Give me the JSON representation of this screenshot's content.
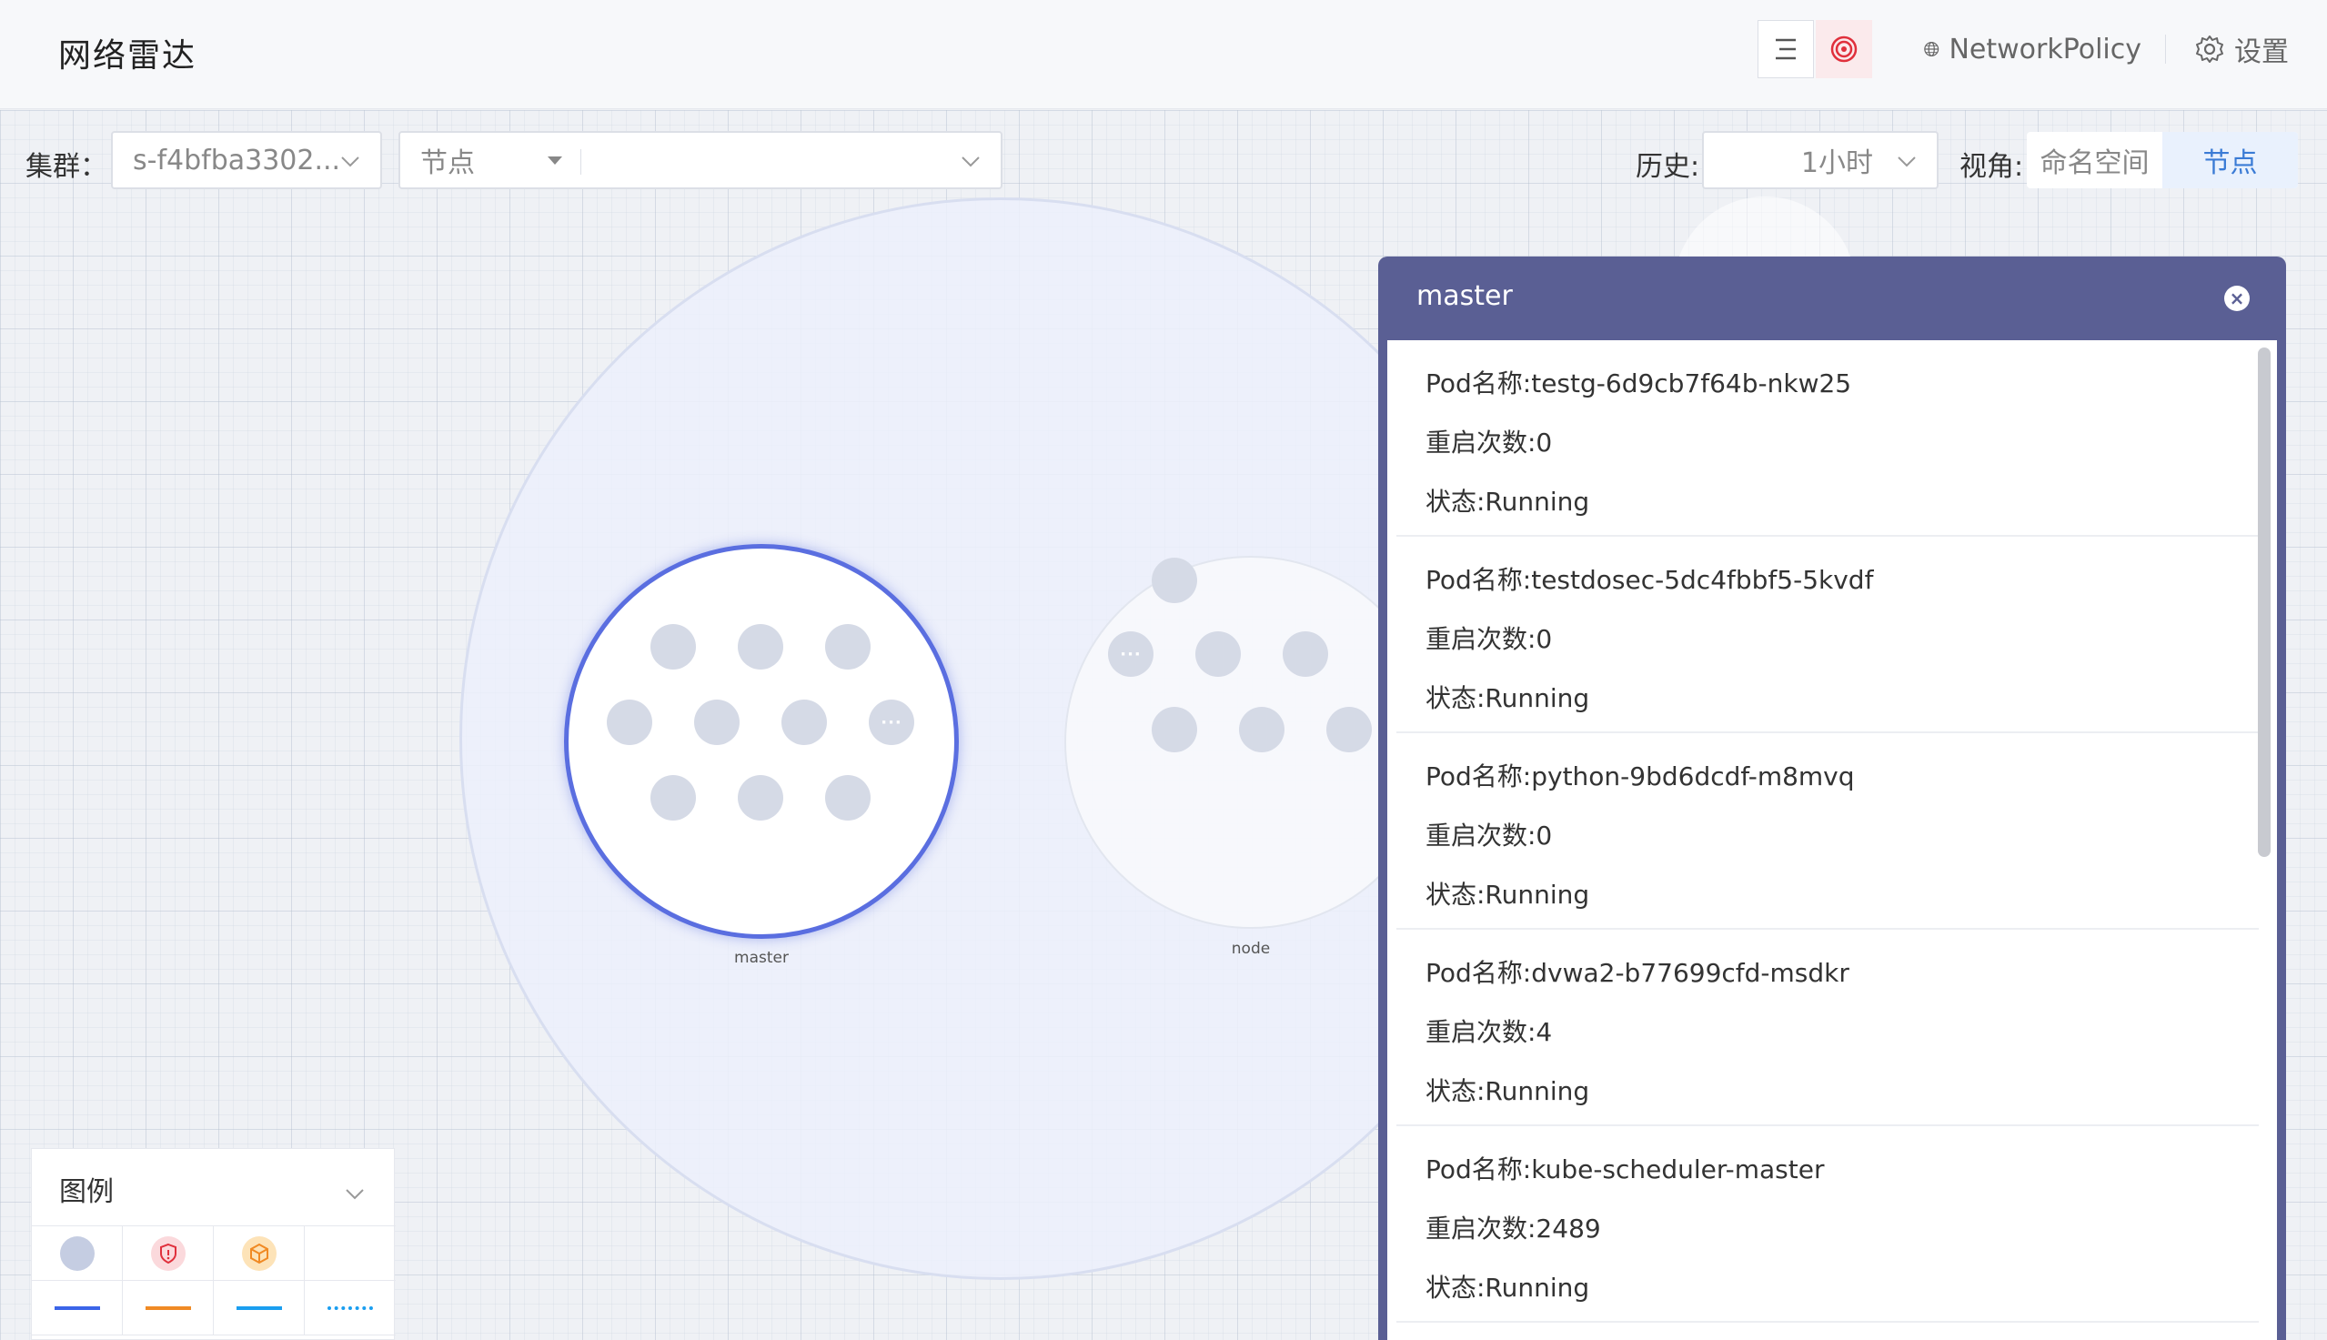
{
  "header": {
    "title": "网络雷达",
    "list_icon": "list-icon",
    "radar_icon": "radar-icon",
    "network_policy_label": "NetworkPolicy",
    "settings_label": "设置"
  },
  "filters": {
    "cluster_label": "集群：",
    "cluster_value": "s-f4bfba3302...",
    "type_value": "节点",
    "type_filter_value": "",
    "history_label": "历史:",
    "history_value": "1小时",
    "view_label": "视角:",
    "view_options": [
      "命名空间",
      "节点"
    ],
    "view_selected": "节点"
  },
  "topology": {
    "nodes": [
      {
        "name": "master",
        "selected": true,
        "more_label": "···"
      },
      {
        "name": "node",
        "selected": false,
        "more_label": "···"
      }
    ]
  },
  "panel": {
    "title": "master",
    "pods": [
      {
        "name": "Pod名称:testg-6d9cb7f64b-nkw25",
        "restarts": "重启次数:0",
        "status": "状态:Running"
      },
      {
        "name": "Pod名称:testdosec-5dc4fbbf5-5kvdf",
        "restarts": "重启次数:0",
        "status": "状态:Running"
      },
      {
        "name": "Pod名称:python-9bd6dcdf-m8mvq",
        "restarts": "重启次数:0",
        "status": "状态:Running"
      },
      {
        "name": "Pod名称:dvwa2-b77699cfd-msdkr",
        "restarts": "重启次数:4",
        "status": "状态:Running"
      },
      {
        "name": "Pod名称:kube-scheduler-master",
        "restarts": "重启次数:2489",
        "status": "状态:Running"
      }
    ]
  },
  "legend": {
    "title": "图例",
    "icons": [
      "pod-circle-icon",
      "shield-icon",
      "cube-icon"
    ],
    "line_colors": [
      "#3b64e8",
      "#f08a24",
      "#1a9ef0",
      "#1a9ef0"
    ],
    "colors": {
      "accent": "#3a7bd5",
      "panel_header": "#5a5f94",
      "selected_node_border": "#5a6ee0"
    }
  }
}
